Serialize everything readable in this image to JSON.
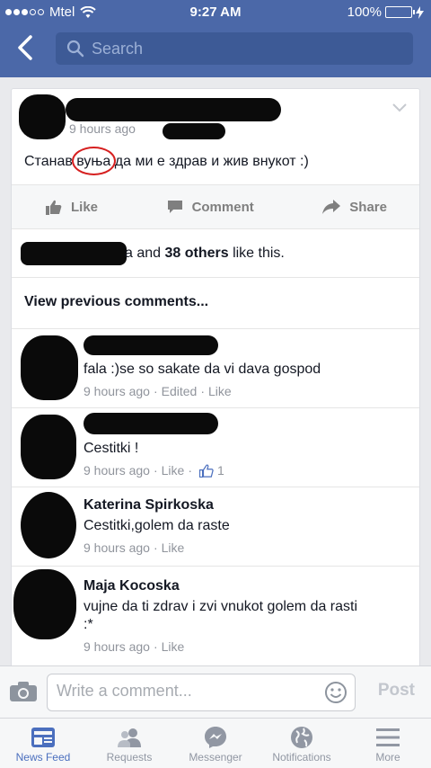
{
  "status_bar": {
    "carrier": "Mtel",
    "time": "9:27 AM",
    "battery": "100%"
  },
  "header": {
    "search_placeholder": "Search"
  },
  "post": {
    "time": "9 hours ago",
    "text_before": "Станав ",
    "text_circled": "вуња",
    "text_after": " да ми е здрав и жив внукот  :)",
    "actions": {
      "like": "Like",
      "comment": "Comment",
      "share": "Share"
    },
    "likes": {
      "suffix": "a and ",
      "others": "38 others",
      "tail": " like this."
    },
    "view_previous": "View previous comments..."
  },
  "comments": [
    {
      "name": "",
      "text": "fala :)se so sakate da vi dava gospod",
      "time": "9 hours ago",
      "edited": "Edited",
      "like": "Like"
    },
    {
      "name": "",
      "text": "Cestitki !",
      "time": "9 hours ago",
      "like": "Like",
      "like_count": "1"
    },
    {
      "name": "Katerina Spirkoska",
      "text": "Cestitki,golem da raste",
      "time": "9 hours ago",
      "like": "Like"
    },
    {
      "name": "Maja Kocoska",
      "text": "vujne da ti zdrav i zvi vnukot golem da rasti :*",
      "time": "9 hours ago",
      "like": "Like"
    }
  ],
  "composer": {
    "placeholder": "Write a comment...",
    "post_label": "Post"
  },
  "tabs": [
    {
      "label": "News Feed",
      "icon": "news-feed-icon",
      "active": true
    },
    {
      "label": "Requests",
      "icon": "friend-requests-icon",
      "active": false
    },
    {
      "label": "Messenger",
      "icon": "messenger-icon",
      "active": false
    },
    {
      "label": "Notifications",
      "icon": "globe-icon",
      "active": false
    },
    {
      "label": "More",
      "icon": "menu-icon",
      "active": false
    }
  ],
  "colors": {
    "brand": "#4b68a8",
    "search_bg": "#3d5a96",
    "active_tab": "#4b6fbe",
    "annotation": "#d62020"
  }
}
